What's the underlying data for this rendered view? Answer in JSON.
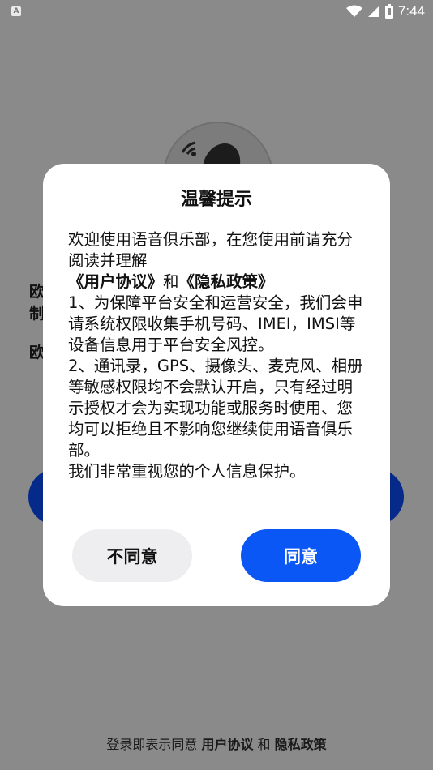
{
  "status_bar": {
    "left_icon": "A",
    "time": "7:44",
    "icons": [
      "wifi-icon",
      "cellular-icon",
      "battery-icon"
    ]
  },
  "background": {
    "line1": "欧",
    "line2": "制",
    "line3": "欧",
    "footer_prefix": "登录即表示同意",
    "footer_agreement": "用户协议",
    "footer_and": "和",
    "footer_privacy": "隐私政策"
  },
  "dialog": {
    "title": "温馨提示",
    "intro": "欢迎使用语音俱乐部，在您使用前请充分阅读并理解",
    "links_line": {
      "agreement": "《用户协议》",
      "and": "和",
      "privacy": "《隐私政策》"
    },
    "para1": "1、为保障平台安全和运营安全，我们会申请系统权限收集手机号码、IMEI，IMSI等设备信息用于平台安全风控。",
    "para2": "2、通讯录，GPS、摄像头、麦克风、相册等敏感权限均不会默认开启，只有经过明示授权才会为实现功能或服务时使用、您均可以拒绝且不影响您继续使用语音俱乐部。",
    "para3": "我们非常重视您的个人信息保护。",
    "disagree_label": "不同意",
    "agree_label": "同意"
  },
  "colors": {
    "overlay": "#8a8a8a",
    "agree_button": "#0a57f5",
    "disagree_button": "#eeeef0",
    "dialog_bg": "#ffffff"
  }
}
